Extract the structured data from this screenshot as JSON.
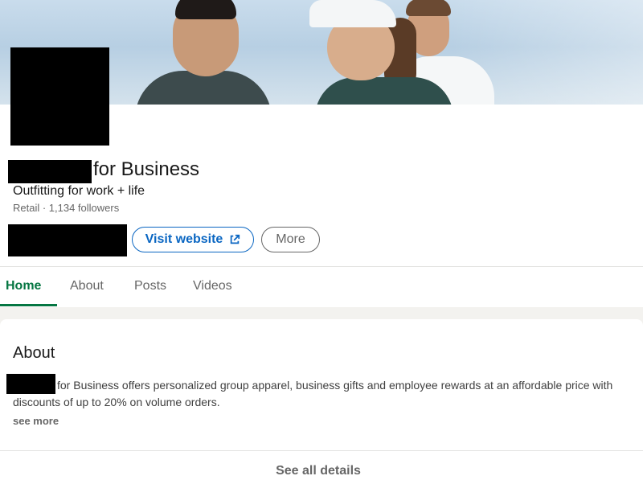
{
  "profile": {
    "company_name": "for Business",
    "tagline": "Outfitting for work + life",
    "meta": "Retail · 1,134 followers"
  },
  "actions": {
    "visit_website_label": "Visit website",
    "more_label": "More"
  },
  "tabs": [
    {
      "label": "Home",
      "active": true
    },
    {
      "label": "About",
      "active": false
    },
    {
      "label": "Posts",
      "active": false
    },
    {
      "label": "Videos",
      "active": false
    }
  ],
  "about": {
    "heading": "About",
    "description": "for Business offers personalized group apparel, business gifts and employee rewards at an affordable price with discounts of up to 20% on volume orders.",
    "see_more_label": "see more",
    "see_all_label": "See all details"
  },
  "colors": {
    "link_blue": "#0a66c2",
    "active_green": "#057642",
    "muted_gray": "#666666",
    "redaction": "#000000"
  },
  "icons": {
    "visit_website": "external-link-icon"
  }
}
